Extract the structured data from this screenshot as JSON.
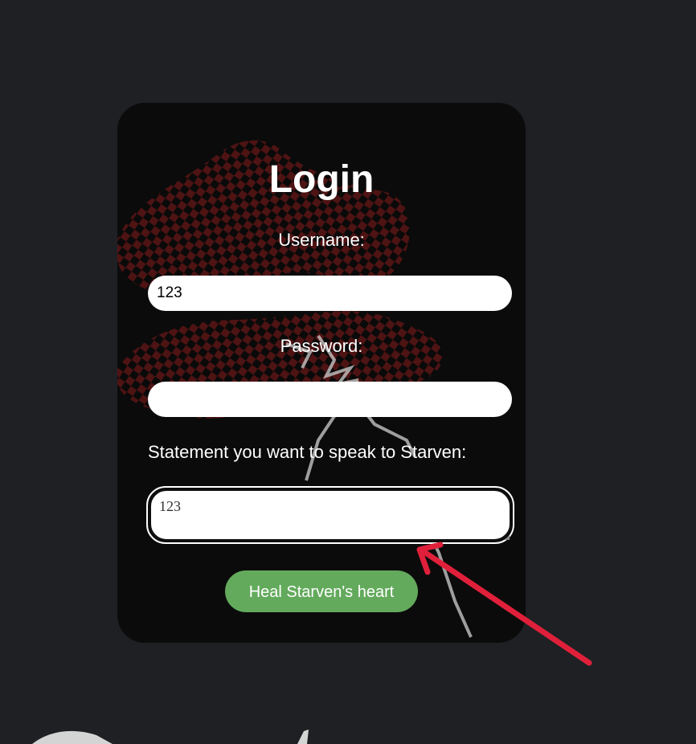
{
  "login": {
    "title": "Login",
    "username_label": "Username:",
    "username_value": "123",
    "password_label": "Password:",
    "password_value": "",
    "statement_label": "Statement you want to speak to Starven:",
    "statement_value": "123",
    "submit_label": "Heal Starven's heart"
  },
  "colors": {
    "page_background": "#1f2024",
    "card_background": "#0b0b0b",
    "button_background": "#63aa5c",
    "annotation_arrow": "#e0203a"
  },
  "icons": {
    "annotation": "red-arrow-icon"
  }
}
